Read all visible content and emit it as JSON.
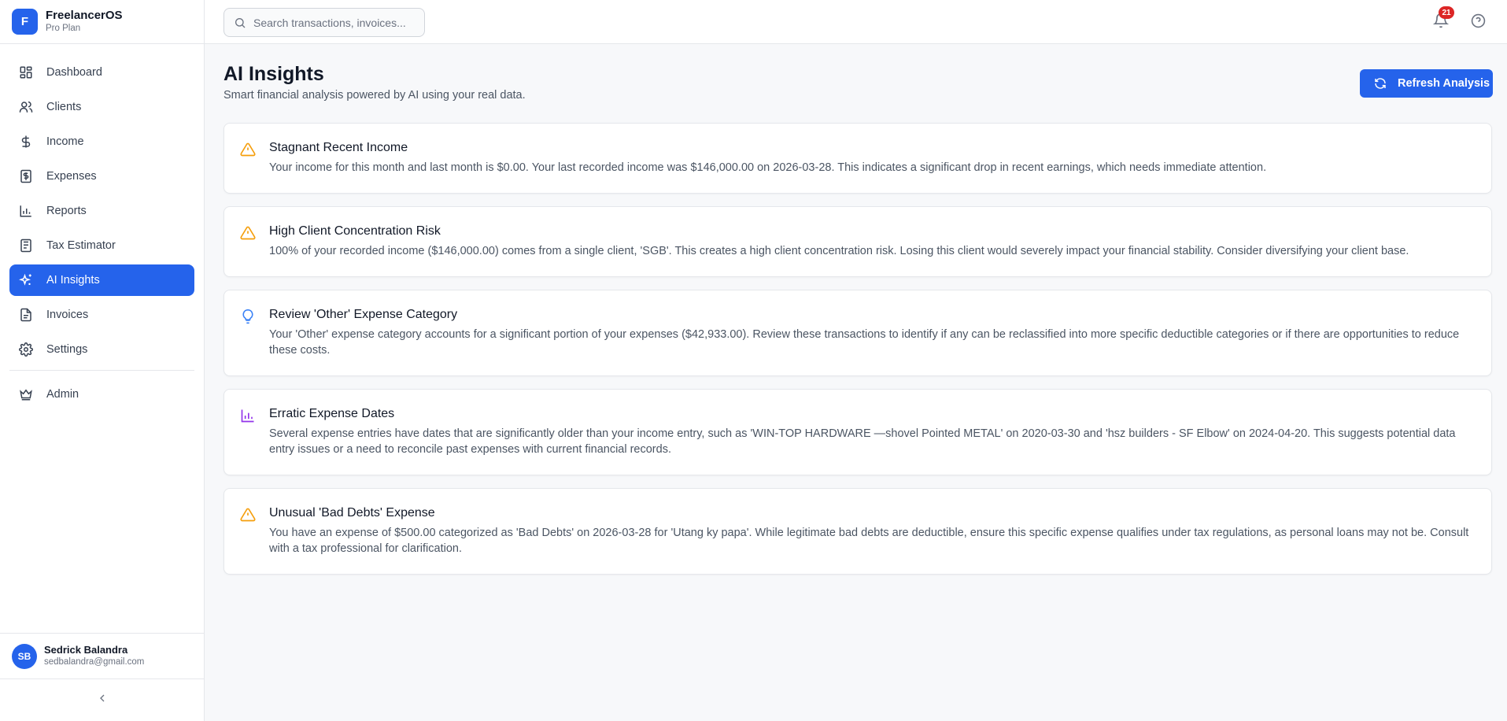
{
  "brand": {
    "initial": "F",
    "name": "FreelancerOS",
    "plan": "Pro Plan"
  },
  "sidebar": {
    "items": [
      {
        "label": "Dashboard",
        "icon": "dashboard-icon"
      },
      {
        "label": "Clients",
        "icon": "users-icon"
      },
      {
        "label": "Income",
        "icon": "dollar-icon"
      },
      {
        "label": "Expenses",
        "icon": "receipt-icon"
      },
      {
        "label": "Reports",
        "icon": "bar-chart-icon"
      },
      {
        "label": "Tax Estimator",
        "icon": "calculator-icon"
      },
      {
        "label": "AI Insights",
        "icon": "sparkles-icon",
        "active": true
      },
      {
        "label": "Invoices",
        "icon": "file-text-icon"
      },
      {
        "label": "Settings",
        "icon": "gear-icon"
      }
    ],
    "admin": {
      "label": "Admin",
      "icon": "crown-icon"
    }
  },
  "user": {
    "initials": "SB",
    "name": "Sedrick Balandra",
    "email": "sedbalandra@gmail.com"
  },
  "topbar": {
    "search_placeholder": "Search transactions, invoices...",
    "notification_count": "21"
  },
  "page": {
    "title": "AI Insights",
    "subtitle": "Smart financial analysis powered by AI using your real data.",
    "refresh_label": "Refresh Analysis"
  },
  "insights": [
    {
      "icon": "warning-icon",
      "title": "Stagnant Recent Income",
      "body": "Your income for this month and last month is $0.00. Your last recorded income was $146,000.00 on 2026-03-28. This indicates a significant drop in recent earnings, which needs immediate attention."
    },
    {
      "icon": "warning-icon",
      "title": "High Client Concentration Risk",
      "body": "100% of your recorded income ($146,000.00) comes from a single client, 'SGB'. This creates a high client concentration risk. Losing this client would severely impact your financial stability. Consider diversifying your client base."
    },
    {
      "icon": "lightbulb-icon",
      "title": "Review 'Other' Expense Category",
      "body": "Your 'Other' expense category accounts for a significant portion of your expenses ($42,933.00). Review these transactions to identify if any can be reclassified into more specific deductible categories or if there are opportunities to reduce these costs."
    },
    {
      "icon": "bar-chart-icon",
      "title": "Erratic Expense Dates",
      "body": "Several expense entries have dates that are significantly older than your income entry, such as 'WIN-TOP HARDWARE —shovel Pointed METAL' on 2020-03-30 and 'hsz builders - SF Elbow' on 2024-04-20. This suggests potential data entry issues or a need to reconcile past expenses with current financial records."
    },
    {
      "icon": "warning-icon",
      "title": "Unusual 'Bad Debts' Expense",
      "body": "You have an expense of $500.00 categorized as 'Bad Debts' on 2026-03-28 for 'Utang ky papa'. While legitimate bad debts are deductible, ensure this specific expense qualifies under tax regulations, as personal loans may not be. Consult with a tax professional for clarification."
    }
  ],
  "colors": {
    "accent": "#2563eb",
    "warning": "#f59e0b",
    "info": "#3b82f6",
    "chart": "#9333ea",
    "badge": "#dc2626"
  }
}
